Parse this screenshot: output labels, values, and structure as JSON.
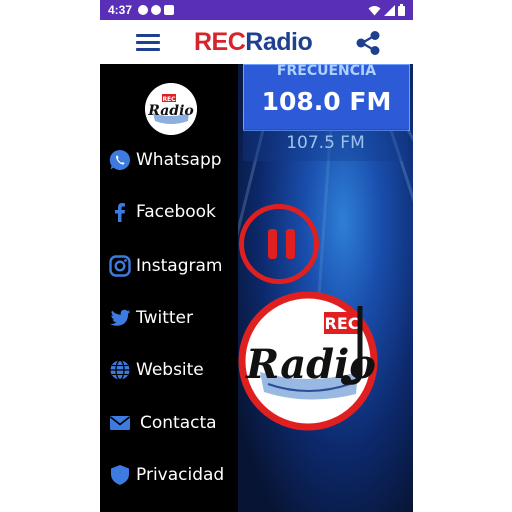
{
  "status_bar": {
    "time": "4:37"
  },
  "app_bar": {
    "brand_rec": "REC",
    "brand_radio": "Radio",
    "menu_icon": "menu-icon",
    "share_icon": "share-icon"
  },
  "drawer": {
    "items": [
      {
        "label": "Whatsapp",
        "icon": "whatsapp-icon"
      },
      {
        "label": "Facebook",
        "icon": "facebook-icon"
      },
      {
        "label": "Instagram",
        "icon": "instagram-icon"
      },
      {
        "label": "Twitter",
        "icon": "twitter-icon"
      },
      {
        "label": "Website",
        "icon": "globe-icon"
      },
      {
        "label": "Contacta",
        "icon": "mail-icon"
      },
      {
        "label": "Privacidad",
        "icon": "shield-icon"
      }
    ]
  },
  "player": {
    "frequency_title": "FRECUENCIA",
    "current_frequency": "108.0 FM",
    "next_frequency": "107.5 FM",
    "state": "playing"
  },
  "colors": {
    "status_bar": "#5a2fb7",
    "brand_red": "#d8232a",
    "brand_blue": "#1f3f8f",
    "accent_red": "#e02020"
  }
}
